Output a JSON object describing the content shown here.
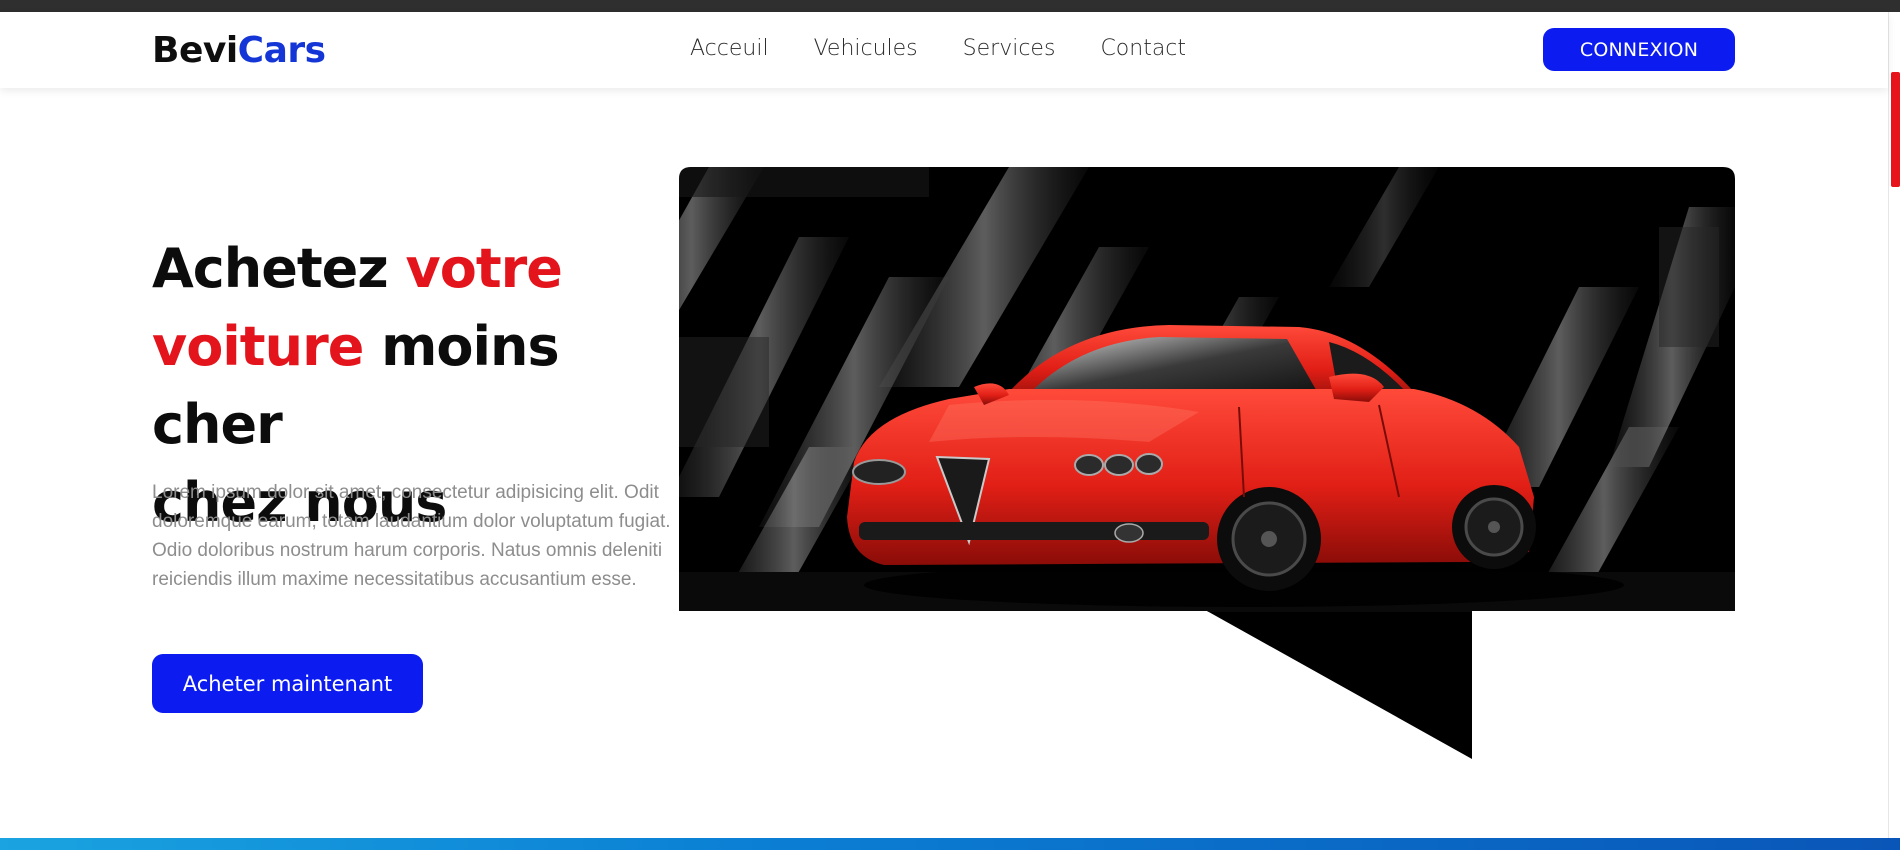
{
  "brand": {
    "part1": "Bevi",
    "part2": "Cars"
  },
  "nav": {
    "links": [
      "Acceuil",
      "Vehicules",
      "Services",
      "Contact"
    ],
    "login_label": "CONNEXION"
  },
  "hero": {
    "title_parts": {
      "a": "Achetez ",
      "b": "votre",
      "c": "voiture",
      "d": " moins cher",
      "e": "chez nous"
    },
    "description": "Lorem ipsum dolor sit amet, consectetur adipisicing elit. Odit doloremque earum, totam laudantium dolor voluptatum fugiat. Odio doloribus nostrum harum corporis. Natus omnis deleniti reiciendis illum maxime necessitatibus accusantium esse.",
    "cta_label": "Acheter maintenant"
  },
  "colors": {
    "accent_blue": "#0c1cf0",
    "accent_red": "#e3141b",
    "logo_blue": "#1436d6"
  }
}
